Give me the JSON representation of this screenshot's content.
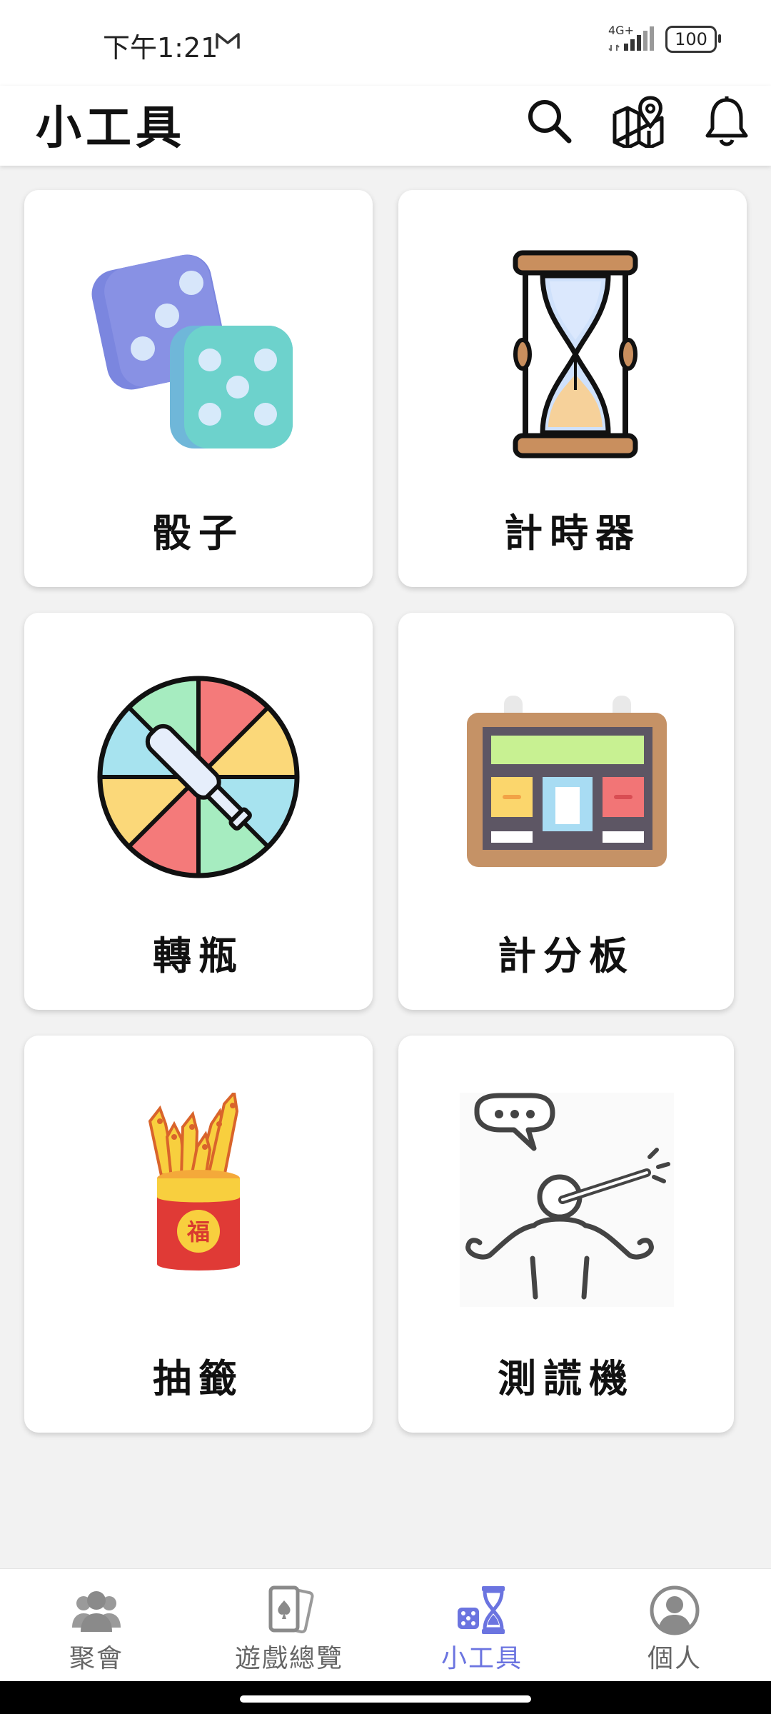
{
  "status_bar": {
    "time": "下午1:21",
    "network": "4G+",
    "battery": "100"
  },
  "app_bar": {
    "title": "小工具"
  },
  "tools": [
    {
      "label": "骰子",
      "icon": "dice-icon"
    },
    {
      "label": "計時器",
      "icon": "hourglass-icon"
    },
    {
      "label": "轉瓶",
      "icon": "spin-bottle-icon"
    },
    {
      "label": "計分板",
      "icon": "scoreboard-icon"
    },
    {
      "label": "抽籤",
      "icon": "fortune-sticks-icon"
    },
    {
      "label": "測謊機",
      "icon": "lie-detector-icon"
    }
  ],
  "bottom_nav": {
    "items": [
      {
        "label": "聚會",
        "icon": "people-icon",
        "active": false
      },
      {
        "label": "遊戲總覽",
        "icon": "cards-icon",
        "active": false
      },
      {
        "label": "小工具",
        "icon": "tools-icon",
        "active": true
      },
      {
        "label": "個人",
        "icon": "person-icon",
        "active": false
      }
    ]
  },
  "colors": {
    "accent": "#6b74e0",
    "background": "#f2f2f2",
    "card": "#ffffff"
  }
}
